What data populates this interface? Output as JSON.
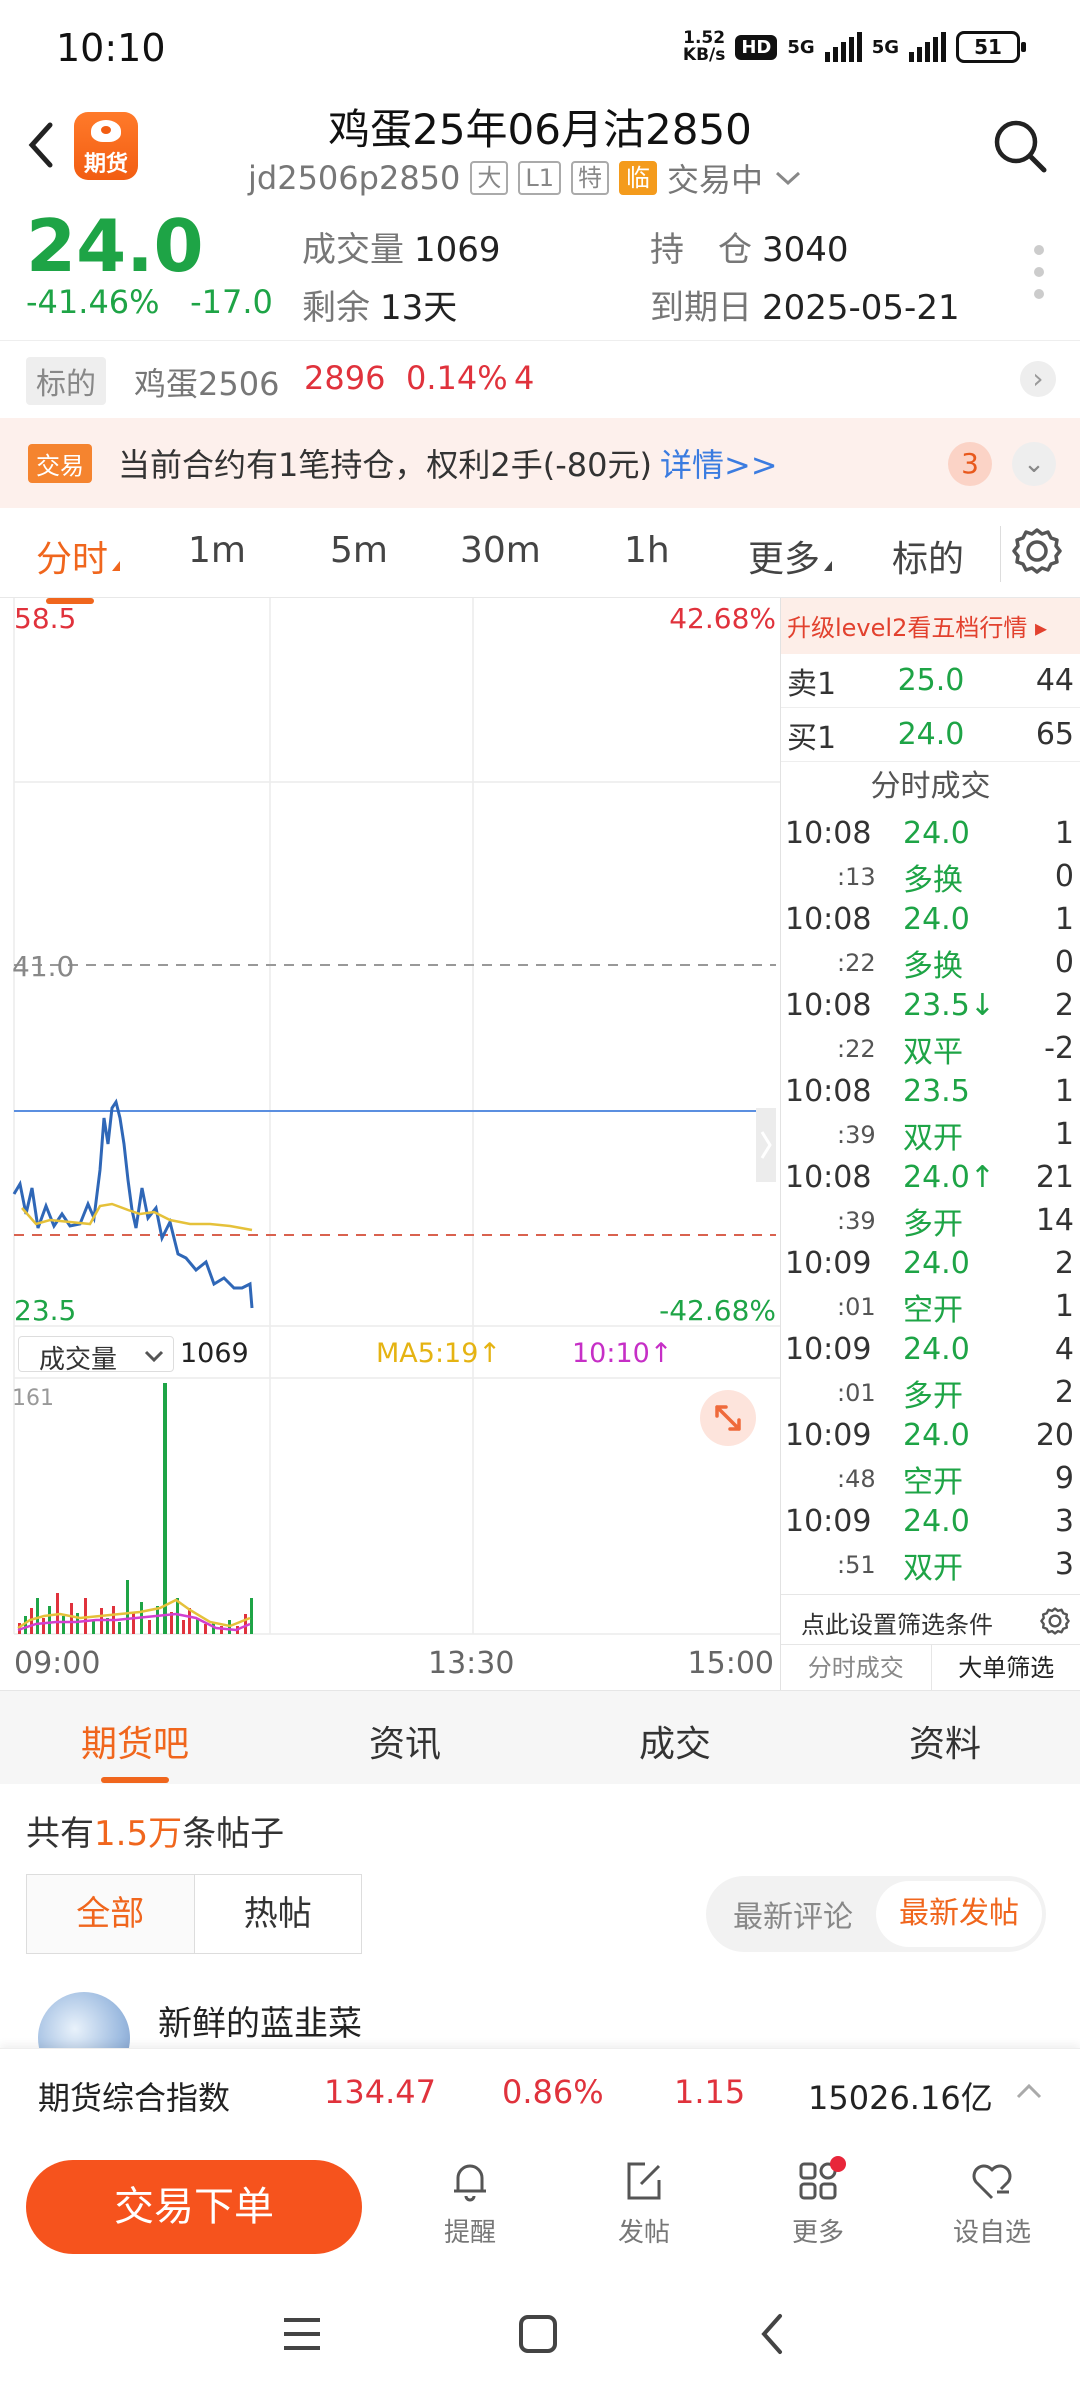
{
  "status": {
    "time": "10:10",
    "net_speed": "1.52",
    "net_unit": "KB/s",
    "hd": "HD",
    "sig1": "5G",
    "sig2": "5G",
    "battery": "51"
  },
  "header": {
    "title": "鸡蛋25年06月沽2850",
    "code": "jd2506p2850",
    "tags": [
      "大",
      "L1",
      "特",
      "临"
    ],
    "status": "交易中",
    "logo_text": "期货"
  },
  "quote": {
    "price": "24.0",
    "change_pct": "-41.46%",
    "change": "-17.0",
    "volume_label": "成交量",
    "volume": "1069",
    "remain_label": "剩余",
    "remain": "13天",
    "oi_label": "持　仓",
    "oi": "3040",
    "expiry_label": "到期日",
    "expiry": "2025-05-21"
  },
  "underlying": {
    "label": "标的",
    "name": "鸡蛋2506",
    "price": "2896",
    "pct": "0.14%",
    "chg": "4"
  },
  "notice": {
    "tag": "交易",
    "text": "当前合约有1笔持仓，权利2手(-80元)",
    "link": "详情>>",
    "count": "3"
  },
  "period_tabs": [
    "分时",
    "1m",
    "5m",
    "30m",
    "1h",
    "更多",
    "标的"
  ],
  "chart": {
    "price_high": "58.5",
    "pct_high": "42.68%",
    "ref_price": "41.0",
    "price_low": "23.5",
    "pct_low": "-42.68%",
    "vol_select": "成交量",
    "vol_value": "1069",
    "ma5": "MA5:19↑",
    "ma_time": "10:10↑",
    "vol_max": "161",
    "time_start": "09:00",
    "time_mid": "13:30",
    "time_end": "15:00"
  },
  "orderbook": {
    "banner": "升级level2看五档行情 ▸",
    "sell": {
      "label": "卖1",
      "price": "25.0",
      "vol": "44"
    },
    "buy": {
      "label": "买1",
      "price": "24.0",
      "vol": "65"
    },
    "ticks_title": "分时成交",
    "ticks": [
      {
        "time": "10:08",
        "sec": ":13",
        "price": "24.0",
        "arrow": "",
        "vol": "1",
        "type": "多换",
        "oi": "0"
      },
      {
        "time": "10:08",
        "sec": ":22",
        "price": "24.0",
        "arrow": "",
        "vol": "1",
        "type": "多换",
        "oi": "0"
      },
      {
        "time": "10:08",
        "sec": ":22",
        "price": "23.5↓",
        "arrow": "",
        "vol": "2",
        "type": "双平",
        "oi": "-2"
      },
      {
        "time": "10:08",
        "sec": ":39",
        "price": "23.5",
        "arrow": "",
        "vol": "1",
        "type": "双开",
        "oi": "1"
      },
      {
        "time": "10:08",
        "sec": ":39",
        "price": "24.0↑",
        "arrow": "",
        "vol": "21",
        "type": "多开",
        "oi": "14"
      },
      {
        "time": "10:09",
        "sec": ":01",
        "price": "24.0",
        "arrow": "",
        "vol": "2",
        "type": "空开",
        "oi": "1"
      },
      {
        "time": "10:09",
        "sec": ":01",
        "price": "24.0",
        "arrow": "",
        "vol": "4",
        "type": "多开",
        "oi": "2"
      },
      {
        "time": "10:09",
        "sec": ":48",
        "price": "24.0",
        "arrow": "",
        "vol": "20",
        "type": "空开",
        "oi": "9"
      },
      {
        "time": "10:09",
        "sec": ":51",
        "price": "24.0",
        "arrow": "",
        "vol": "3",
        "type": "双开",
        "oi": "3"
      }
    ],
    "filter": "点此设置筛选条件",
    "tab1": "分时成交",
    "tab2": "大单筛选"
  },
  "community_tabs": [
    "期货吧",
    "资讯",
    "成交",
    "资料"
  ],
  "posts": {
    "prefix": "共有",
    "count": "1.5万",
    "suffix": "条帖子",
    "seg_all": "全部",
    "seg_hot": "热帖",
    "sort_comment": "最新评论",
    "sort_post": "最新发帖",
    "first_user": "新鲜的蓝韭菜"
  },
  "index_bar": {
    "name": "期货综合指数",
    "value": "134.47",
    "pct": "0.86%",
    "chg": "1.15",
    "amount": "15026.16亿"
  },
  "bottom": {
    "trade": "交易下单",
    "remind": "提醒",
    "post": "发帖",
    "more": "更多",
    "watch": "设自选"
  }
}
